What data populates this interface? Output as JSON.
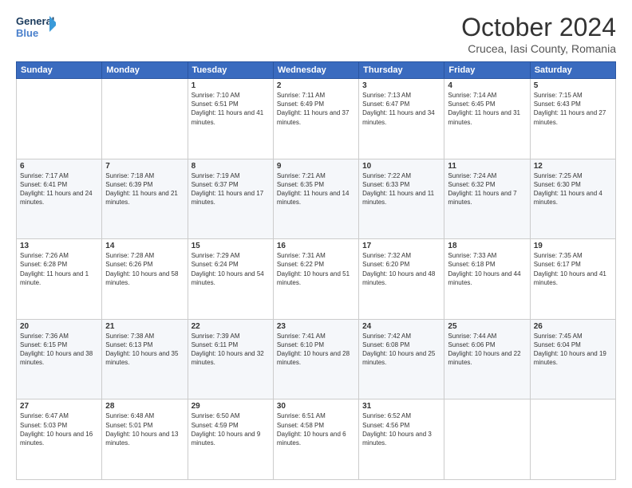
{
  "logo": {
    "line1": "General",
    "line2": "Blue"
  },
  "title": "October 2024",
  "subtitle": "Crucea, Iasi County, Romania",
  "weekdays": [
    "Sunday",
    "Monday",
    "Tuesday",
    "Wednesday",
    "Thursday",
    "Friday",
    "Saturday"
  ],
  "weeks": [
    [
      {
        "day": "",
        "sunrise": "",
        "sunset": "",
        "daylight": ""
      },
      {
        "day": "",
        "sunrise": "",
        "sunset": "",
        "daylight": ""
      },
      {
        "day": "1",
        "sunrise": "Sunrise: 7:10 AM",
        "sunset": "Sunset: 6:51 PM",
        "daylight": "Daylight: 11 hours and 41 minutes."
      },
      {
        "day": "2",
        "sunrise": "Sunrise: 7:11 AM",
        "sunset": "Sunset: 6:49 PM",
        "daylight": "Daylight: 11 hours and 37 minutes."
      },
      {
        "day": "3",
        "sunrise": "Sunrise: 7:13 AM",
        "sunset": "Sunset: 6:47 PM",
        "daylight": "Daylight: 11 hours and 34 minutes."
      },
      {
        "day": "4",
        "sunrise": "Sunrise: 7:14 AM",
        "sunset": "Sunset: 6:45 PM",
        "daylight": "Daylight: 11 hours and 31 minutes."
      },
      {
        "day": "5",
        "sunrise": "Sunrise: 7:15 AM",
        "sunset": "Sunset: 6:43 PM",
        "daylight": "Daylight: 11 hours and 27 minutes."
      }
    ],
    [
      {
        "day": "6",
        "sunrise": "Sunrise: 7:17 AM",
        "sunset": "Sunset: 6:41 PM",
        "daylight": "Daylight: 11 hours and 24 minutes."
      },
      {
        "day": "7",
        "sunrise": "Sunrise: 7:18 AM",
        "sunset": "Sunset: 6:39 PM",
        "daylight": "Daylight: 11 hours and 21 minutes."
      },
      {
        "day": "8",
        "sunrise": "Sunrise: 7:19 AM",
        "sunset": "Sunset: 6:37 PM",
        "daylight": "Daylight: 11 hours and 17 minutes."
      },
      {
        "day": "9",
        "sunrise": "Sunrise: 7:21 AM",
        "sunset": "Sunset: 6:35 PM",
        "daylight": "Daylight: 11 hours and 14 minutes."
      },
      {
        "day": "10",
        "sunrise": "Sunrise: 7:22 AM",
        "sunset": "Sunset: 6:33 PM",
        "daylight": "Daylight: 11 hours and 11 minutes."
      },
      {
        "day": "11",
        "sunrise": "Sunrise: 7:24 AM",
        "sunset": "Sunset: 6:32 PM",
        "daylight": "Daylight: 11 hours and 7 minutes."
      },
      {
        "day": "12",
        "sunrise": "Sunrise: 7:25 AM",
        "sunset": "Sunset: 6:30 PM",
        "daylight": "Daylight: 11 hours and 4 minutes."
      }
    ],
    [
      {
        "day": "13",
        "sunrise": "Sunrise: 7:26 AM",
        "sunset": "Sunset: 6:28 PM",
        "daylight": "Daylight: 11 hours and 1 minute."
      },
      {
        "day": "14",
        "sunrise": "Sunrise: 7:28 AM",
        "sunset": "Sunset: 6:26 PM",
        "daylight": "Daylight: 10 hours and 58 minutes."
      },
      {
        "day": "15",
        "sunrise": "Sunrise: 7:29 AM",
        "sunset": "Sunset: 6:24 PM",
        "daylight": "Daylight: 10 hours and 54 minutes."
      },
      {
        "day": "16",
        "sunrise": "Sunrise: 7:31 AM",
        "sunset": "Sunset: 6:22 PM",
        "daylight": "Daylight: 10 hours and 51 minutes."
      },
      {
        "day": "17",
        "sunrise": "Sunrise: 7:32 AM",
        "sunset": "Sunset: 6:20 PM",
        "daylight": "Daylight: 10 hours and 48 minutes."
      },
      {
        "day": "18",
        "sunrise": "Sunrise: 7:33 AM",
        "sunset": "Sunset: 6:18 PM",
        "daylight": "Daylight: 10 hours and 44 minutes."
      },
      {
        "day": "19",
        "sunrise": "Sunrise: 7:35 AM",
        "sunset": "Sunset: 6:17 PM",
        "daylight": "Daylight: 10 hours and 41 minutes."
      }
    ],
    [
      {
        "day": "20",
        "sunrise": "Sunrise: 7:36 AM",
        "sunset": "Sunset: 6:15 PM",
        "daylight": "Daylight: 10 hours and 38 minutes."
      },
      {
        "day": "21",
        "sunrise": "Sunrise: 7:38 AM",
        "sunset": "Sunset: 6:13 PM",
        "daylight": "Daylight: 10 hours and 35 minutes."
      },
      {
        "day": "22",
        "sunrise": "Sunrise: 7:39 AM",
        "sunset": "Sunset: 6:11 PM",
        "daylight": "Daylight: 10 hours and 32 minutes."
      },
      {
        "day": "23",
        "sunrise": "Sunrise: 7:41 AM",
        "sunset": "Sunset: 6:10 PM",
        "daylight": "Daylight: 10 hours and 28 minutes."
      },
      {
        "day": "24",
        "sunrise": "Sunrise: 7:42 AM",
        "sunset": "Sunset: 6:08 PM",
        "daylight": "Daylight: 10 hours and 25 minutes."
      },
      {
        "day": "25",
        "sunrise": "Sunrise: 7:44 AM",
        "sunset": "Sunset: 6:06 PM",
        "daylight": "Daylight: 10 hours and 22 minutes."
      },
      {
        "day": "26",
        "sunrise": "Sunrise: 7:45 AM",
        "sunset": "Sunset: 6:04 PM",
        "daylight": "Daylight: 10 hours and 19 minutes."
      }
    ],
    [
      {
        "day": "27",
        "sunrise": "Sunrise: 6:47 AM",
        "sunset": "Sunset: 5:03 PM",
        "daylight": "Daylight: 10 hours and 16 minutes."
      },
      {
        "day": "28",
        "sunrise": "Sunrise: 6:48 AM",
        "sunset": "Sunset: 5:01 PM",
        "daylight": "Daylight: 10 hours and 13 minutes."
      },
      {
        "day": "29",
        "sunrise": "Sunrise: 6:50 AM",
        "sunset": "Sunset: 4:59 PM",
        "daylight": "Daylight: 10 hours and 9 minutes."
      },
      {
        "day": "30",
        "sunrise": "Sunrise: 6:51 AM",
        "sunset": "Sunset: 4:58 PM",
        "daylight": "Daylight: 10 hours and 6 minutes."
      },
      {
        "day": "31",
        "sunrise": "Sunrise: 6:52 AM",
        "sunset": "Sunset: 4:56 PM",
        "daylight": "Daylight: 10 hours and 3 minutes."
      },
      {
        "day": "",
        "sunrise": "",
        "sunset": "",
        "daylight": ""
      },
      {
        "day": "",
        "sunrise": "",
        "sunset": "",
        "daylight": ""
      }
    ]
  ]
}
